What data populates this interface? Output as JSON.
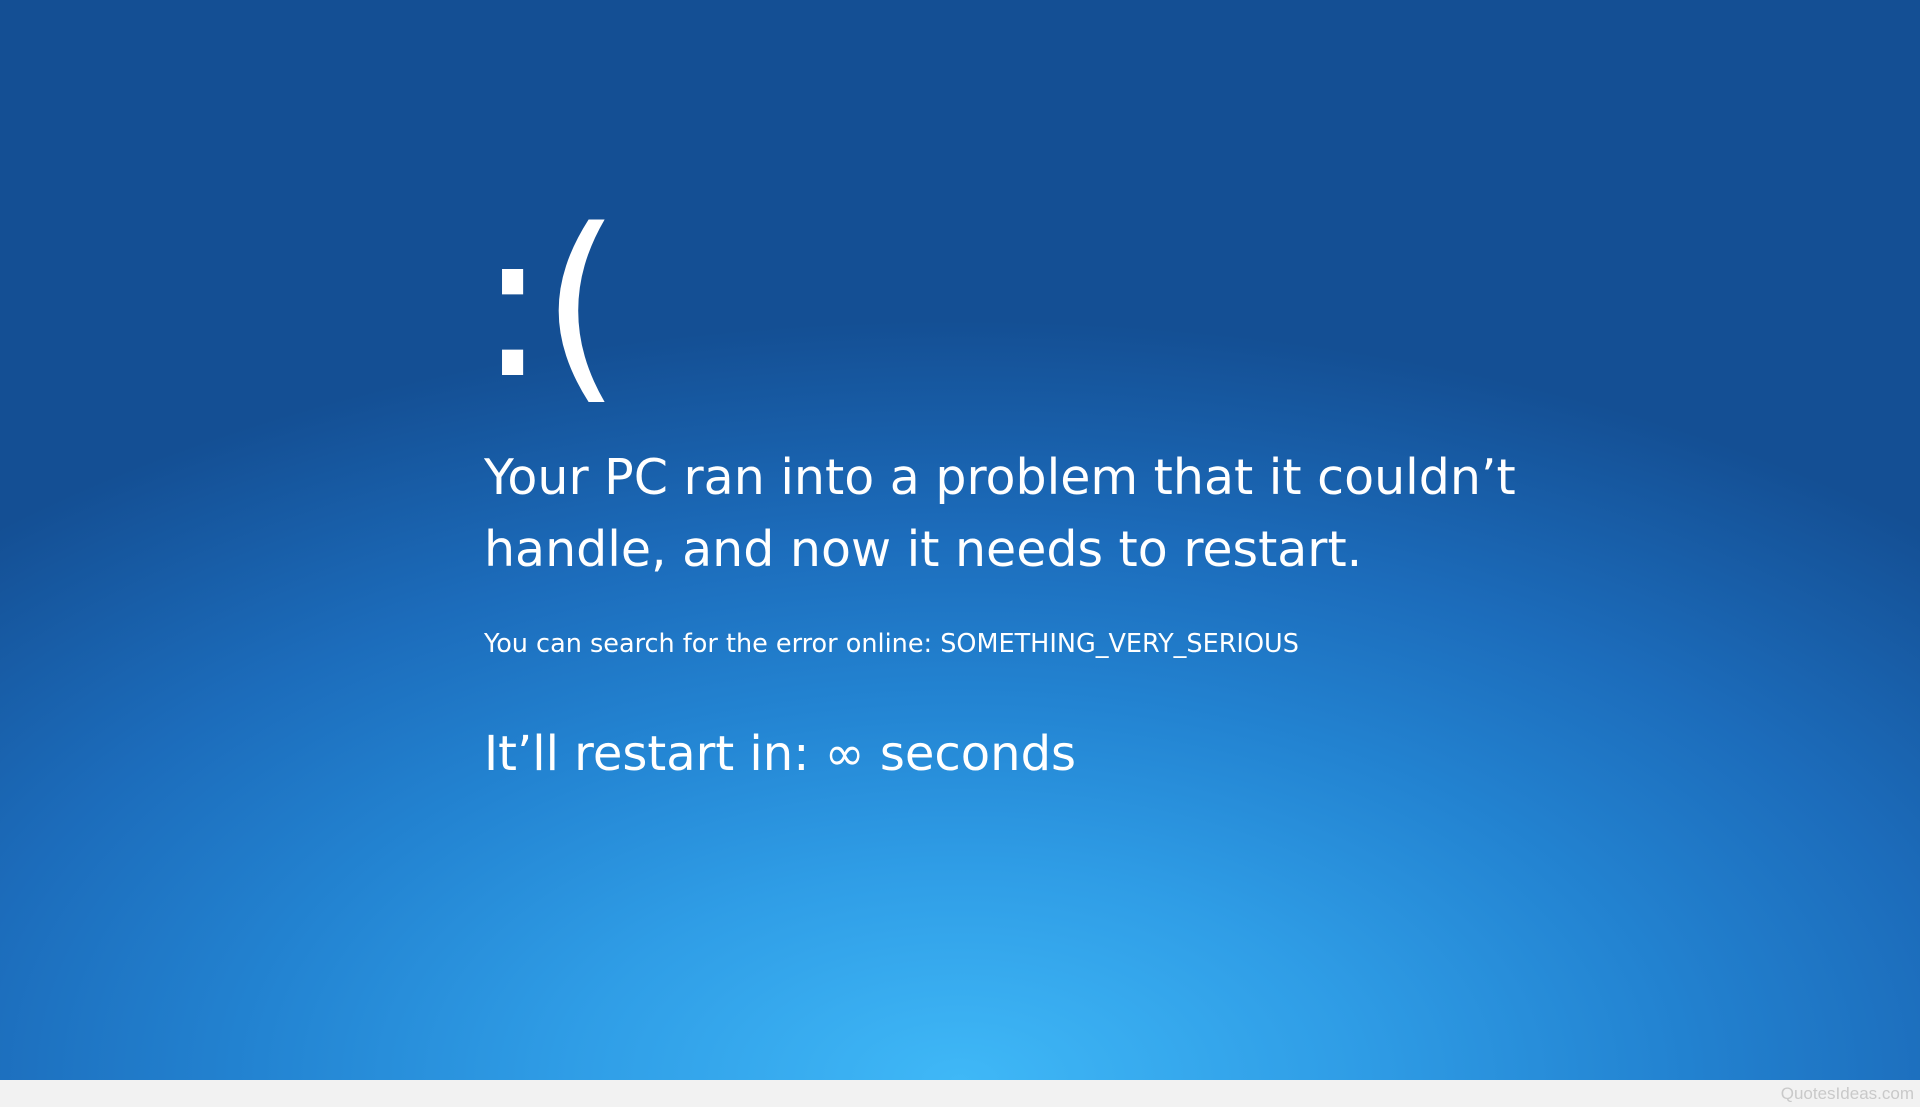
{
  "screen": {
    "sad_face": ":(",
    "headline": "Your PC ran into a problem that it couldn’t handle, and now it needs to restart.",
    "search_line": "You can search for the error online: SOMETHING_VERY_SERIOUS",
    "restart_line": "It’ll restart in: ∞ seconds",
    "colors": {
      "background_top": "#144f94",
      "background_bottom": "#3fb8f7",
      "text": "#ffffff"
    }
  },
  "footer": {
    "watermark": "QuotesIdeas.com"
  }
}
